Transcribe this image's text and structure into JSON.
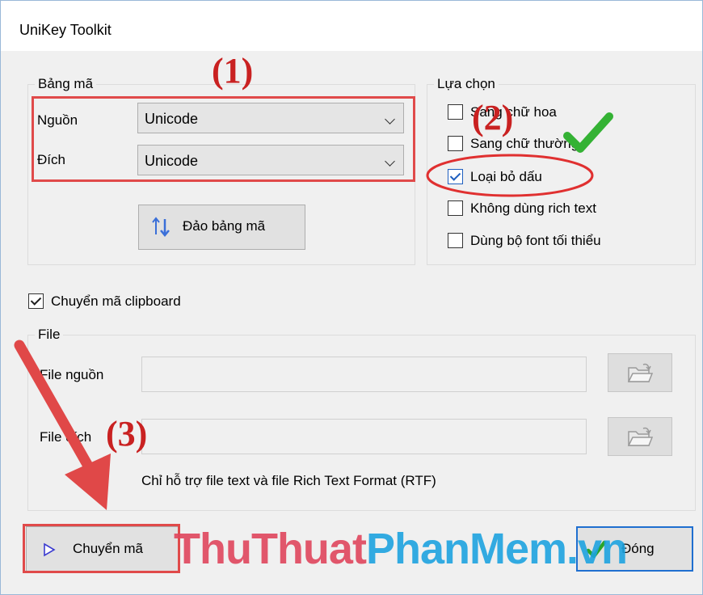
{
  "window": {
    "title": "UniKey Toolkit"
  },
  "bang_ma": {
    "legend": "Bảng mã",
    "source_label": "Nguồn",
    "source_value": "Unicode",
    "target_label": "Đích",
    "target_value": "Unicode",
    "swap_button": "Đảo bảng mã"
  },
  "lua_chon": {
    "legend": "Lựa chọn",
    "options": [
      {
        "label": "Sang chữ hoa",
        "checked": false
      },
      {
        "label": "Sang chữ thường",
        "checked": false
      },
      {
        "label": "Loại bỏ dấu",
        "checked": true
      },
      {
        "label": "Không dùng rich text",
        "checked": false
      },
      {
        "label": "Dùng bộ font tối thiểu",
        "checked": false
      }
    ]
  },
  "clipboard": {
    "label": "Chuyển mã clipboard",
    "checked": true
  },
  "file": {
    "legend": "File",
    "source_label": "File nguồn",
    "source_value": "",
    "target_label": "File đích",
    "target_value": "",
    "note": "Chỉ hỗ trợ file text và file Rich Text Format (RTF)"
  },
  "footer": {
    "convert_button": "Chuyển mã",
    "close_button": "Đóng"
  },
  "annotations": {
    "step1": "(1)",
    "step2": "(2)",
    "step3": "(3)"
  },
  "watermark": {
    "part1": "ThuThuat",
    "part2": "PhanMem.vn"
  },
  "colors": {
    "annotation_red": "#e04a4a",
    "focus_blue": "#1f6fd0",
    "check_green": "#2aa52a",
    "watermark_pink": "#e0465d",
    "watermark_blue": "#1ea3e0"
  },
  "icons": [
    "swap-arrows-icon",
    "folder-open-icon",
    "play-triangle-icon",
    "green-check-icon",
    "red-arrow-icon"
  ]
}
